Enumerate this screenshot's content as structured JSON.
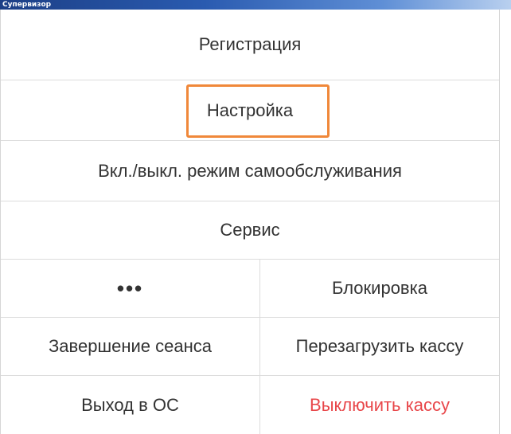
{
  "window": {
    "title": "Супервизор"
  },
  "menu": {
    "registration": "Регистрация",
    "settings": "Настройка",
    "self_service_toggle": "Вкл./выкл. режим самообслуживания",
    "service": "Сервис",
    "more": "•••",
    "lock": "Блокировка",
    "end_session": "Завершение сеанса",
    "restart_register": "Перезагрузить кассу",
    "exit_to_os": "Выход в ОС",
    "shutdown_register": "Выключить кассу"
  },
  "colors": {
    "highlight_border": "#f0883a",
    "danger_text": "#e8474a",
    "title_bar": "#1c3f86"
  },
  "highlighted_item": "settings"
}
